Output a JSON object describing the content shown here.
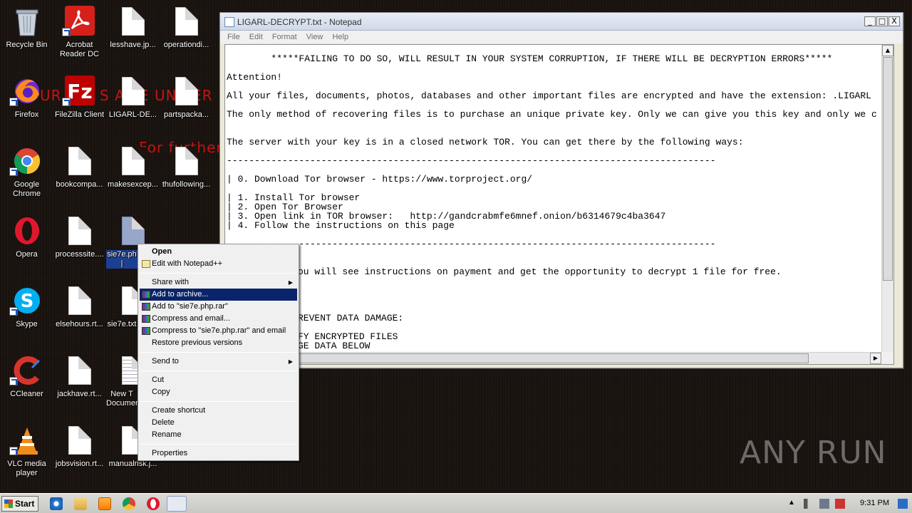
{
  "desktop": {
    "icons": [
      {
        "label": "Recycle Bin",
        "icon": "recycle-bin-icon"
      },
      {
        "label": "Acrobat Reader DC",
        "icon": "acrobat-icon"
      },
      {
        "label": "lesshave.jp...",
        "icon": "file-icon"
      },
      {
        "label": "operationdi...",
        "icon": "file-icon"
      },
      {
        "label": "Firefox",
        "icon": "firefox-icon"
      },
      {
        "label": "FileZilla Client",
        "icon": "filezilla-icon"
      },
      {
        "label": "LIGARL-DE...",
        "icon": "file-icon"
      },
      {
        "label": "partspacka...",
        "icon": "file-icon"
      },
      {
        "label": "Google Chrome",
        "icon": "chrome-icon"
      },
      {
        "label": "bookcompa...",
        "icon": "file-icon"
      },
      {
        "label": "makesexcep...",
        "icon": "file-icon"
      },
      {
        "label": "thufollowing...",
        "icon": "file-icon"
      },
      {
        "label": "Opera",
        "icon": "opera-icon"
      },
      {
        "label": "processsite....",
        "icon": "file-icon"
      },
      {
        "label": "sie7e.ph\n|",
        "icon": "file-icon"
      },
      {
        "label": "Skype",
        "icon": "skype-icon"
      },
      {
        "label": "elsehours.rt...",
        "icon": "file-icon"
      },
      {
        "label": "sie7e.txt",
        "icon": "file-icon"
      },
      {
        "label": "CCleaner",
        "icon": "ccleaner-icon"
      },
      {
        "label": "jackhave.rt...",
        "icon": "file-icon"
      },
      {
        "label": "New T\nDocumen",
        "icon": "text-file-icon"
      },
      {
        "label": "VLC media player",
        "icon": "vlc-icon"
      },
      {
        "label": "jobsvision.rt...",
        "icon": "file-icon"
      },
      {
        "label": "manualrisk.j...",
        "icon": "file-icon"
      }
    ],
    "wallpaper_text": [
      "UR",
      "S A",
      "E UN",
      "ER",
      "For further"
    ]
  },
  "notepad": {
    "title": "LIGARL-DECRYPT.txt - Notepad",
    "menu": [
      "File",
      "Edit",
      "Format",
      "View",
      "Help"
    ],
    "lines": [
      "        *****FAILING TO DO SO, WILL RESULT IN YOUR SYSTEM CORRUPTION, IF THERE WILL BE DECRYPTION ERRORS*****",
      "Attention!",
      "All your files, documents, photos, databases and other important files are encrypted and have the extension: .LIGARL",
      "The only method of recovering files is to purchase an unique private key. Only we can give you this key and only we c",
      "The server with your key is in a closed network TOR. You can get there by the following ways:",
      "----------------------------------------------------------------------------------------",
      "| 0. Download Tor browser - https://www.torproject.org/",
      "| 1. Install Tor browser",
      "| 2. Open Tor Browser",
      "| 3. Open link in TOR browser:   http://gandcrabmfe6mnef.onion/b6314679c4ba3647",
      "| 4. Follow the instructions on this page",
      "----------------------------------------------------------------------------------------",
      "ou will see instructions on payment and get the opportunity to decrypt 1 file for free.",
      "REVENT DATA DAMAGE:",
      "FY ENCRYPTED FILES",
      "GE DATA BELOW"
    ],
    "buttons": {
      "minimize": "_",
      "maximize": "□",
      "close": "X"
    }
  },
  "context_menu": {
    "items": [
      {
        "label": "Open",
        "bold": true
      },
      {
        "label": "Edit with Notepad++",
        "icon": "notepadpp-icon"
      },
      {
        "label": "Share with",
        "submenu": true
      },
      {
        "label": "Add to archive...",
        "icon": "winrar-icon",
        "highlighted": true
      },
      {
        "label": "Add to \"sie7e.php.rar\"",
        "icon": "winrar-icon"
      },
      {
        "label": "Compress and email...",
        "icon": "winrar-icon"
      },
      {
        "label": "Compress to \"sie7e.php.rar\" and email",
        "icon": "winrar-icon"
      },
      {
        "label": "Restore previous versions"
      },
      {
        "label": "Send to",
        "submenu": true
      },
      {
        "label": "Cut"
      },
      {
        "label": "Copy"
      },
      {
        "label": "Create shortcut"
      },
      {
        "label": "Delete"
      },
      {
        "label": "Rename"
      },
      {
        "label": "Properties"
      }
    ]
  },
  "taskbar": {
    "start_label": "Start",
    "clock": "9:31 PM",
    "pinned": [
      "ie-icon",
      "explorer-icon",
      "media-player-icon",
      "chrome-icon",
      "opera-icon",
      "notepad-icon"
    ]
  },
  "watermark": "ANY RUN"
}
